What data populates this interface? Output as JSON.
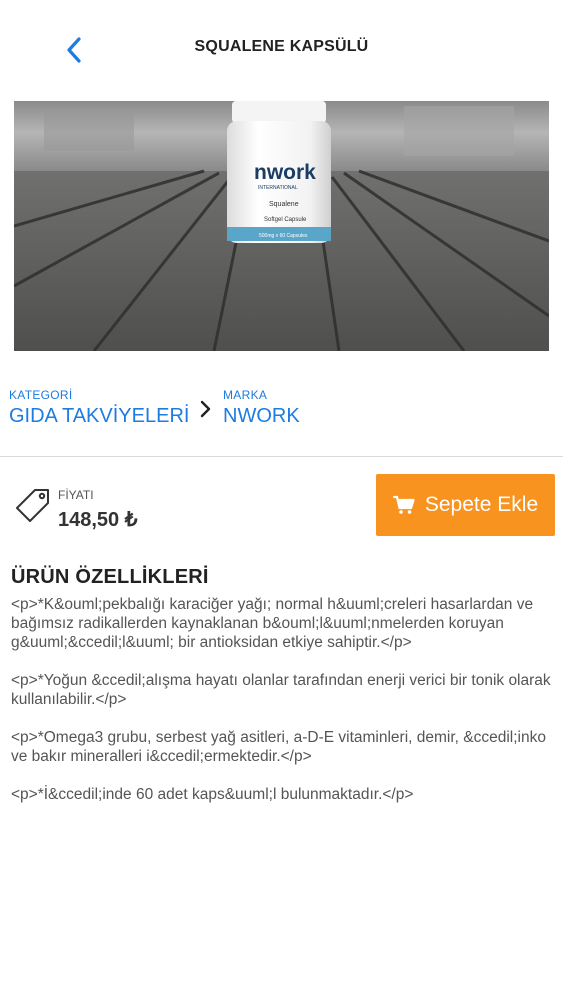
{
  "header": {
    "title": "SQUALENE KAPSÜLÜ",
    "back_icon": "chevron-left-icon"
  },
  "product_image": {
    "brand_text": "nwork",
    "brand_subtext": "INTERNATIONAL",
    "product_name": "Squalene",
    "product_type": "Softgel Capsule",
    "capacity": "500mg x 60 Capsules"
  },
  "meta": {
    "category_label": "KATEGORİ",
    "category_value": "GIDA TAKVİYELERİ",
    "brand_label": "MARKA",
    "brand_value": "NWORK"
  },
  "price": {
    "label": "FİYATI",
    "value": "148,50 ₺"
  },
  "cart_button": {
    "label": "Sepete Ekle",
    "icon": "cart-icon"
  },
  "features": {
    "title": "ÜRÜN ÖZELLİKLERİ",
    "body": "<p>*K&ouml;pekbalığı karaciğer yağı; normal h&uuml;creleri hasarlardan ve bağımsız radikallerden kaynaklanan b&ouml;l&uuml;nmelerden koruyan g&uuml;&ccedil;l&uuml; bir antioksidan etkiye sahiptir.</p>\n\n<p>*Yoğun &ccedil;alışma hayatı olanlar tarafından enerji verici bir tonik olarak kullanılabilir.</p>\n\n<p>*Omega3 grubu, serbest yağ asitleri, a-D-E vitaminleri, demir, &ccedil;inko ve bakır mineralleri i&ccedil;ermektedir.</p>\n\n<p>*İ&ccedil;inde 60 adet kaps&uuml;l bulunmaktadır.</p>"
  },
  "colors": {
    "accent_blue": "#1e7be0",
    "cart_orange": "#f7931e"
  }
}
